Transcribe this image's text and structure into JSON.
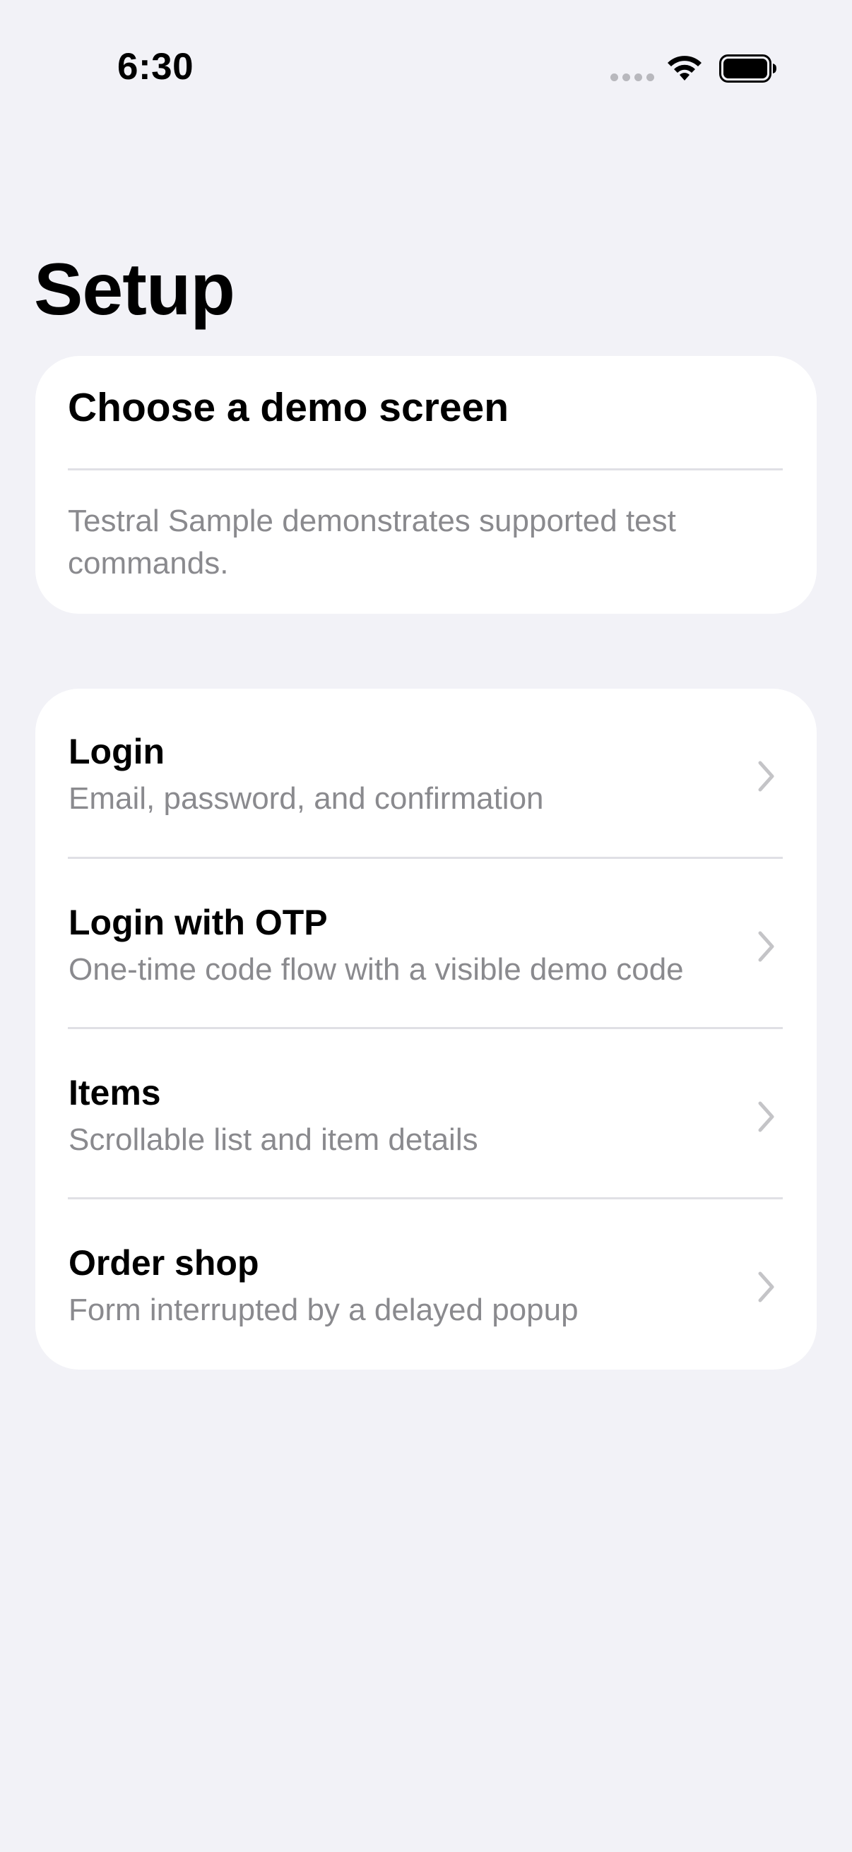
{
  "status_bar": {
    "time": "6:30"
  },
  "page": {
    "title": "Setup"
  },
  "intro": {
    "heading": "Choose a demo screen",
    "description": "Testral Sample demonstrates supported test commands."
  },
  "menu": {
    "items": [
      {
        "title": "Login",
        "subtitle": "Email, password, and confirmation",
        "icon": "chevron-right-icon"
      },
      {
        "title": "Login with OTP",
        "subtitle": "One-time code flow with a visible demo code",
        "icon": "chevron-right-icon"
      },
      {
        "title": "Items",
        "subtitle": "Scrollable list and item details",
        "icon": "chevron-right-icon"
      },
      {
        "title": "Order shop",
        "subtitle": "Form interrupted by a delayed popup",
        "icon": "chevron-right-icon"
      }
    ]
  },
  "colors": {
    "background": "#f2f2f7",
    "card": "#ffffff",
    "secondary_text": "#8a8a8e",
    "chevron": "#c4c4c7"
  }
}
